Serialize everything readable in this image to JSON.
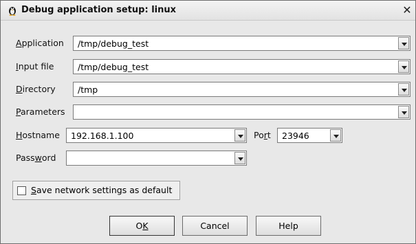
{
  "window": {
    "title": "Debug application setup: linux",
    "close_glyph": "✕"
  },
  "fields": {
    "application": {
      "label_pre": "",
      "label_key": "A",
      "label_post": "pplication",
      "value": "/tmp/debug_test"
    },
    "input_file": {
      "label_pre": "",
      "label_key": "I",
      "label_post": "nput file",
      "value": "/tmp/debug_test"
    },
    "directory": {
      "label_pre": "",
      "label_key": "D",
      "label_post": "irectory",
      "value": "/tmp"
    },
    "parameters": {
      "label_pre": "",
      "label_key": "P",
      "label_post": "arameters",
      "value": ""
    },
    "hostname": {
      "label_pre": "",
      "label_key": "H",
      "label_post": "ostname",
      "value": "192.168.1.100"
    },
    "port": {
      "label_pre": "Po",
      "label_key": "r",
      "label_post": "t",
      "value": "23946"
    },
    "password": {
      "label_pre": "Pass",
      "label_key": "w",
      "label_post": "ord",
      "value": ""
    }
  },
  "save_default": {
    "label_pre": "",
    "label_key": "S",
    "label_post": "ave network settings as default",
    "checked": false
  },
  "buttons": {
    "ok": {
      "pre": "O",
      "key": "K",
      "post": ""
    },
    "cancel": "Cancel",
    "help": "Help"
  }
}
